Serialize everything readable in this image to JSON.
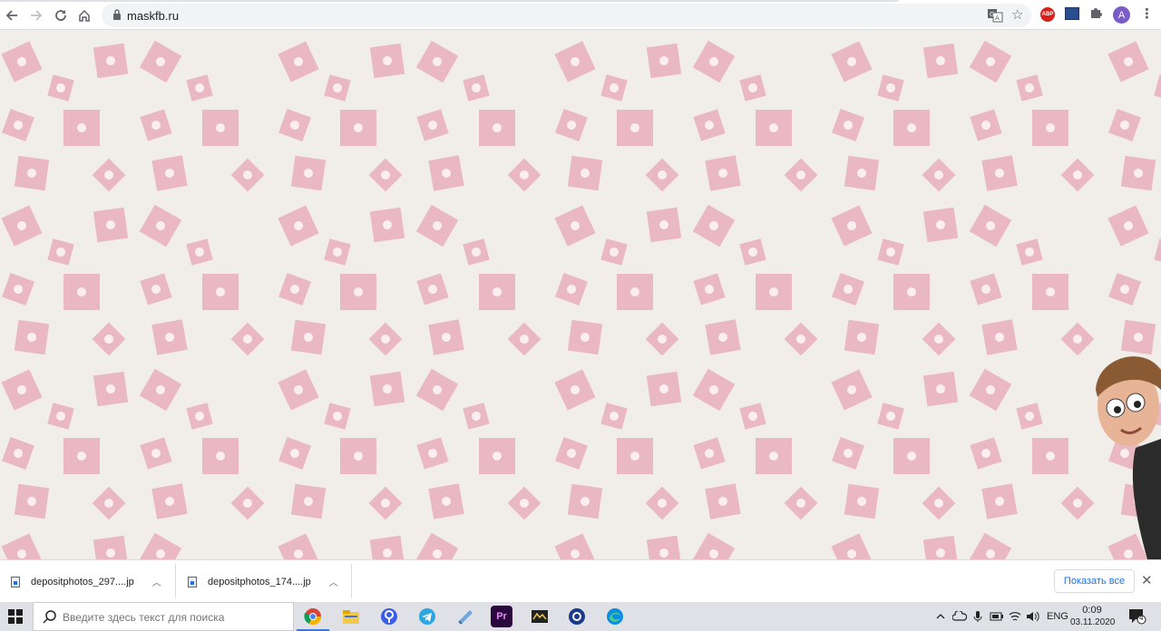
{
  "browser": {
    "url": "maskfb.ru",
    "abp_label": "ABP",
    "profile_initial": "A"
  },
  "downloads": {
    "items": [
      {
        "name": "depositphotos_297....jp"
      },
      {
        "name": "depositphotos_174....jp"
      }
    ],
    "show_all_label": "Показать все"
  },
  "taskbar": {
    "search_placeholder": "Введите здесь текст для поиска",
    "language": "ENG",
    "time": "0:09",
    "date": "03.11.2020",
    "notification_count": "4",
    "apps": [
      "chrome-icon",
      "file-explorer-icon",
      "yandex-icon",
      "telegram-icon",
      "notes-icon",
      "premiere-icon",
      "winamp-icon",
      "obs-icon",
      "edge-icon"
    ]
  },
  "colors": {
    "page_background": "#f1eee9",
    "tile_pink": "#eab8c2",
    "accent_blue": "#1a73e8"
  }
}
